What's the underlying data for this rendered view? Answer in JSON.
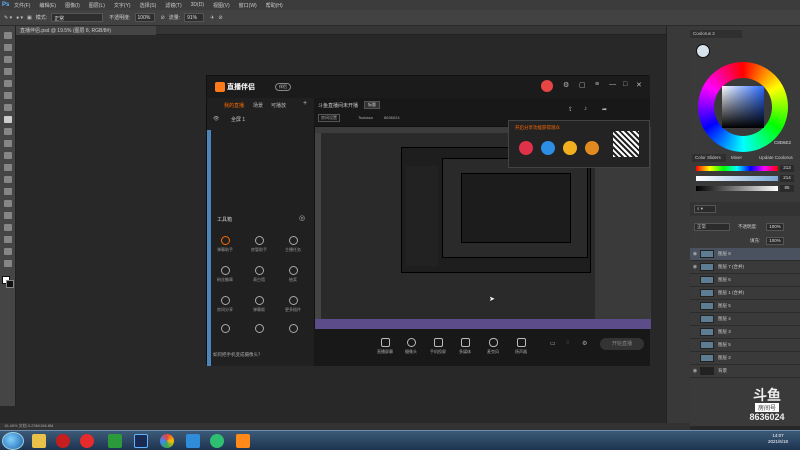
{
  "photoshop": {
    "logo": "Ps",
    "menu": [
      "文件(F)",
      "编辑(E)",
      "图像(I)",
      "图层(L)",
      "文字(Y)",
      "选择(S)",
      "滤镜(T)",
      "3D(D)",
      "视图(V)",
      "窗口(W)",
      "帮助(H)"
    ],
    "options": {
      "mode_label": "模式:",
      "mode_value": "正常",
      "opacity_label": "不透明度:",
      "opacity_value": "100%",
      "flow_label": "流量:",
      "flow_value": "91%"
    },
    "doc_tab": "直播伴侣.psd @ 19.5% (图层 8, RGB/8#)",
    "status": "16.46%    文档:3.23M/166.8M",
    "panels": {
      "color_tab": "Coolorus 2",
      "wheel_hex": "C8D6E2",
      "sliders_tabs": [
        "Color Sliders",
        "Mixer",
        "Update Coolorus"
      ],
      "slider_values": [
        "213",
        "214",
        "85"
      ],
      "layers_mode": "正常",
      "layers_opacity_label": "不透明度:",
      "layers_opacity": "100%",
      "fill_label": "填充:",
      "fill_value": "100%",
      "layers": [
        "图层 8",
        "图层 7 (合并)",
        "图层 6",
        "图层 1 (合并)",
        "图层 5",
        "图层 4",
        "图层 3",
        "图层 5",
        "图层 2",
        "背景"
      ]
    }
  },
  "watermark": {
    "logo": "斗鱼",
    "sub": "房间号",
    "room": "8636024"
  },
  "app": {
    "brand": "直播伴侣",
    "brand_badge": "伴侣",
    "left_tabs": [
      "我的直播",
      "场景",
      "可播放"
    ],
    "scene_item": "全屏 1",
    "tools_title": "工具箱",
    "tools": [
      "弹幕助手",
      "房管助手",
      "主播任务",
      "粉丝徽章",
      "表白墙",
      "抽奖",
      "房间分享",
      "弹幕姬",
      "更多插件",
      "",
      "",
      ""
    ],
    "bottom_tip": "如何把手机变成摄像头？",
    "stream_tab": "斗鱼直播间未开播",
    "stream_title_btn": "标题",
    "stream_meta": [
      "房间设置",
      "Tsukasa",
      "8636024"
    ],
    "popup_title": "开启分享功能获得观众",
    "bottom_buttons": [
      "直播屏幕",
      "摄像头",
      "手机投屏",
      "多媒体",
      "麦克风",
      "扬声器"
    ],
    "start_button": "开始直播"
  },
  "taskbar": {
    "time": "14:07",
    "date": "2021/6/18"
  }
}
